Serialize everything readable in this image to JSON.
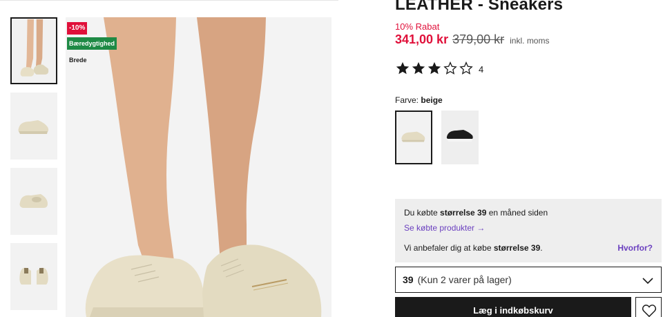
{
  "product": {
    "title": "LEATHER - Sneakers",
    "discount_label": "10% Rabat",
    "price_now": "341,00 kr",
    "price_old": "379,00 kr",
    "vat_note": "inkl. moms"
  },
  "badges": {
    "discount": "-10%",
    "sustainability": "Bæredygtighed",
    "fit": "Brede"
  },
  "rating": {
    "stars": 3,
    "max": 5,
    "count": "4"
  },
  "color": {
    "label": "Farve:",
    "selected": "beige"
  },
  "thumbnails": [
    "thumb-on-feet",
    "thumb-side",
    "thumb-angle",
    "thumb-back"
  ],
  "size_info": {
    "bought_prefix": "Du købte ",
    "bought_size": "størrelse 39",
    "bought_suffix": " en måned siden",
    "link": "Se købte produkter →",
    "recommend_prefix": "Vi anbefaler dig at købe ",
    "recommend_size": "størrelse 39",
    "recommend_suffix": ".",
    "why": "Hvorfor?"
  },
  "size_select": {
    "value": "39",
    "stock": "(Kun 2 varer på lager)"
  },
  "cart_button": "Læg i indkøbskurv",
  "colors": {
    "accent": "#e0103a",
    "link": "#6a3fbf",
    "dark": "#1a1a1a",
    "panel": "#eeeeee"
  }
}
